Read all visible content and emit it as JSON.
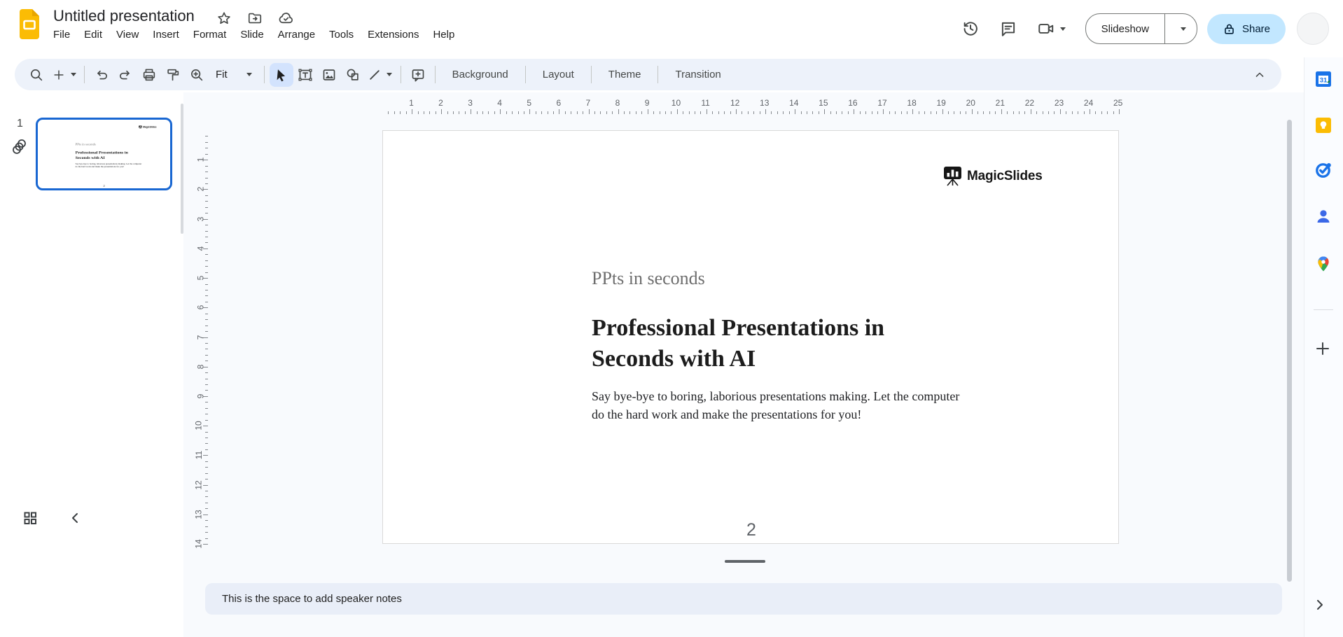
{
  "header": {
    "document_title": "Untitled presentation",
    "menu_items": [
      "File",
      "Edit",
      "View",
      "Insert",
      "Format",
      "Slide",
      "Arrange",
      "Tools",
      "Extensions",
      "Help"
    ],
    "slideshow_button": "Slideshow",
    "share_button": "Share"
  },
  "toolbar": {
    "zoom_value": "Fit",
    "background_button": "Background",
    "layout_button": "Layout",
    "theme_button": "Theme",
    "transition_button": "Transition"
  },
  "filmstrip": {
    "slide_number": "1"
  },
  "rulers": {
    "horizontal_numbers": [
      1,
      2,
      3,
      4,
      5,
      6,
      7,
      8,
      9,
      10,
      11,
      12,
      13,
      14,
      15,
      16,
      17,
      18,
      19,
      20,
      21,
      22,
      23,
      24,
      25
    ],
    "vertical_numbers": [
      1,
      2,
      3,
      4,
      5,
      6,
      7,
      8,
      9,
      10,
      11,
      12,
      13,
      14
    ]
  },
  "slide": {
    "brand_name": "MagicSlides",
    "kicker": "PPts in seconds",
    "title_lines": [
      "Professional Presentations in",
      "Seconds with AI"
    ],
    "body_lines": [
      "Say bye-bye to boring, laborious presentations making. Let the computer",
      "do the hard work and make the presentations for you!"
    ],
    "page_number": "2"
  },
  "notes": {
    "text": "This is the space to add speaker notes"
  },
  "icons": {
    "calendar_day": "31"
  },
  "colors": {
    "accent_blue": "#1a73e8",
    "share_bg": "#c2e7ff",
    "toolbar_bg": "#edf2fa",
    "active_tool_bg": "#d3e3fd",
    "canvas_bg": "#f8fafd",
    "selected_thumb_border": "#1967d2"
  }
}
